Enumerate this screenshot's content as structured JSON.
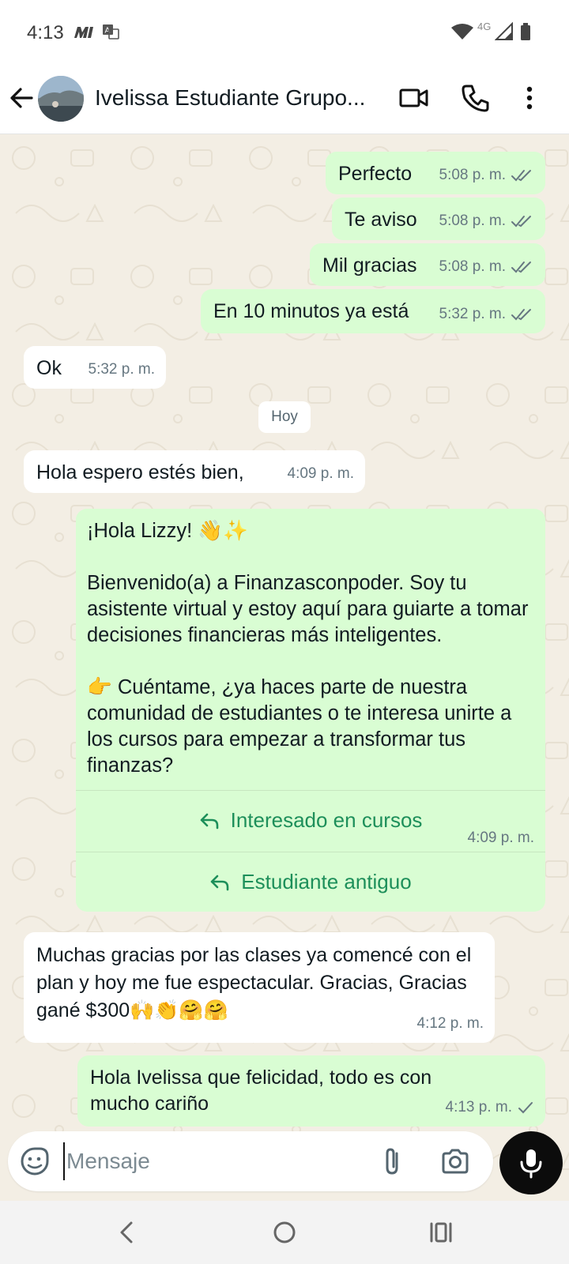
{
  "status_bar": {
    "time": "4:13",
    "network": "4G"
  },
  "header": {
    "contact_name": "Ivelissa Estudiante Grupo...",
    "icons": [
      "back-arrow-icon",
      "video-call-icon",
      "phone-icon",
      "more-vert-icon"
    ]
  },
  "messages": [
    {
      "dir": "out",
      "text": "Perfecto",
      "time": "5:08 p. m.",
      "status": "read"
    },
    {
      "dir": "out",
      "text": "Te aviso",
      "time": "5:08 p. m.",
      "status": "read"
    },
    {
      "dir": "out",
      "text": "Mil gracias",
      "time": "5:08 p. m.",
      "status": "read"
    },
    {
      "dir": "out",
      "text": "En 10 minutos ya está",
      "time": "5:32 p. m.",
      "status": "read"
    },
    {
      "dir": "in",
      "text": "Ok",
      "time": "5:32 p. m."
    },
    {
      "dir": "in",
      "text": "Hola espero estés bien,",
      "time": "4:09 p. m."
    },
    {
      "dir": "out",
      "text": "¡Hola Lizzy! 👋✨\n\nBienvenido(a) a Finanzasconpoder. Soy tu asistente virtual y estoy aquí para guiarte a tomar decisiones financieras más inteligentes.\n\n👉 Cuéntame, ¿ya haces parte de nuestra comunidad de estudiantes o te interesa unirte a los cursos para empezar a transformar tus finanzas?",
      "time": "4:09 p. m.",
      "quick_replies": [
        "Interesado en cursos",
        "Estudiante antiguo"
      ]
    },
    {
      "dir": "in",
      "text": "Muchas gracias por las clases ya comencé con el plan y hoy me fue espectacular.  Gracias, Gracias gané $300🙌👏🤗🤗",
      "time": "4:12 p. m."
    },
    {
      "dir": "out",
      "text": "Hola Ivelissa que felicidad, todo es con mucho cariño",
      "time": "4:13 p. m.",
      "status": "sent"
    }
  ],
  "date_separator": "Hoy",
  "composer": {
    "placeholder": "Mensaje",
    "icons": [
      "sticker-icon",
      "attach-icon",
      "camera-icon",
      "mic-icon"
    ]
  },
  "nav_bar": {
    "icons": [
      "back-nav-icon",
      "home-nav-icon",
      "recents-nav-icon"
    ]
  },
  "colors": {
    "outgoing_bubble": "#d9fdd3",
    "incoming_bubble": "#ffffff",
    "chat_background": "#f3eee4",
    "reply_button_text": "#1d8f5a",
    "read_ticks": "#667781"
  }
}
